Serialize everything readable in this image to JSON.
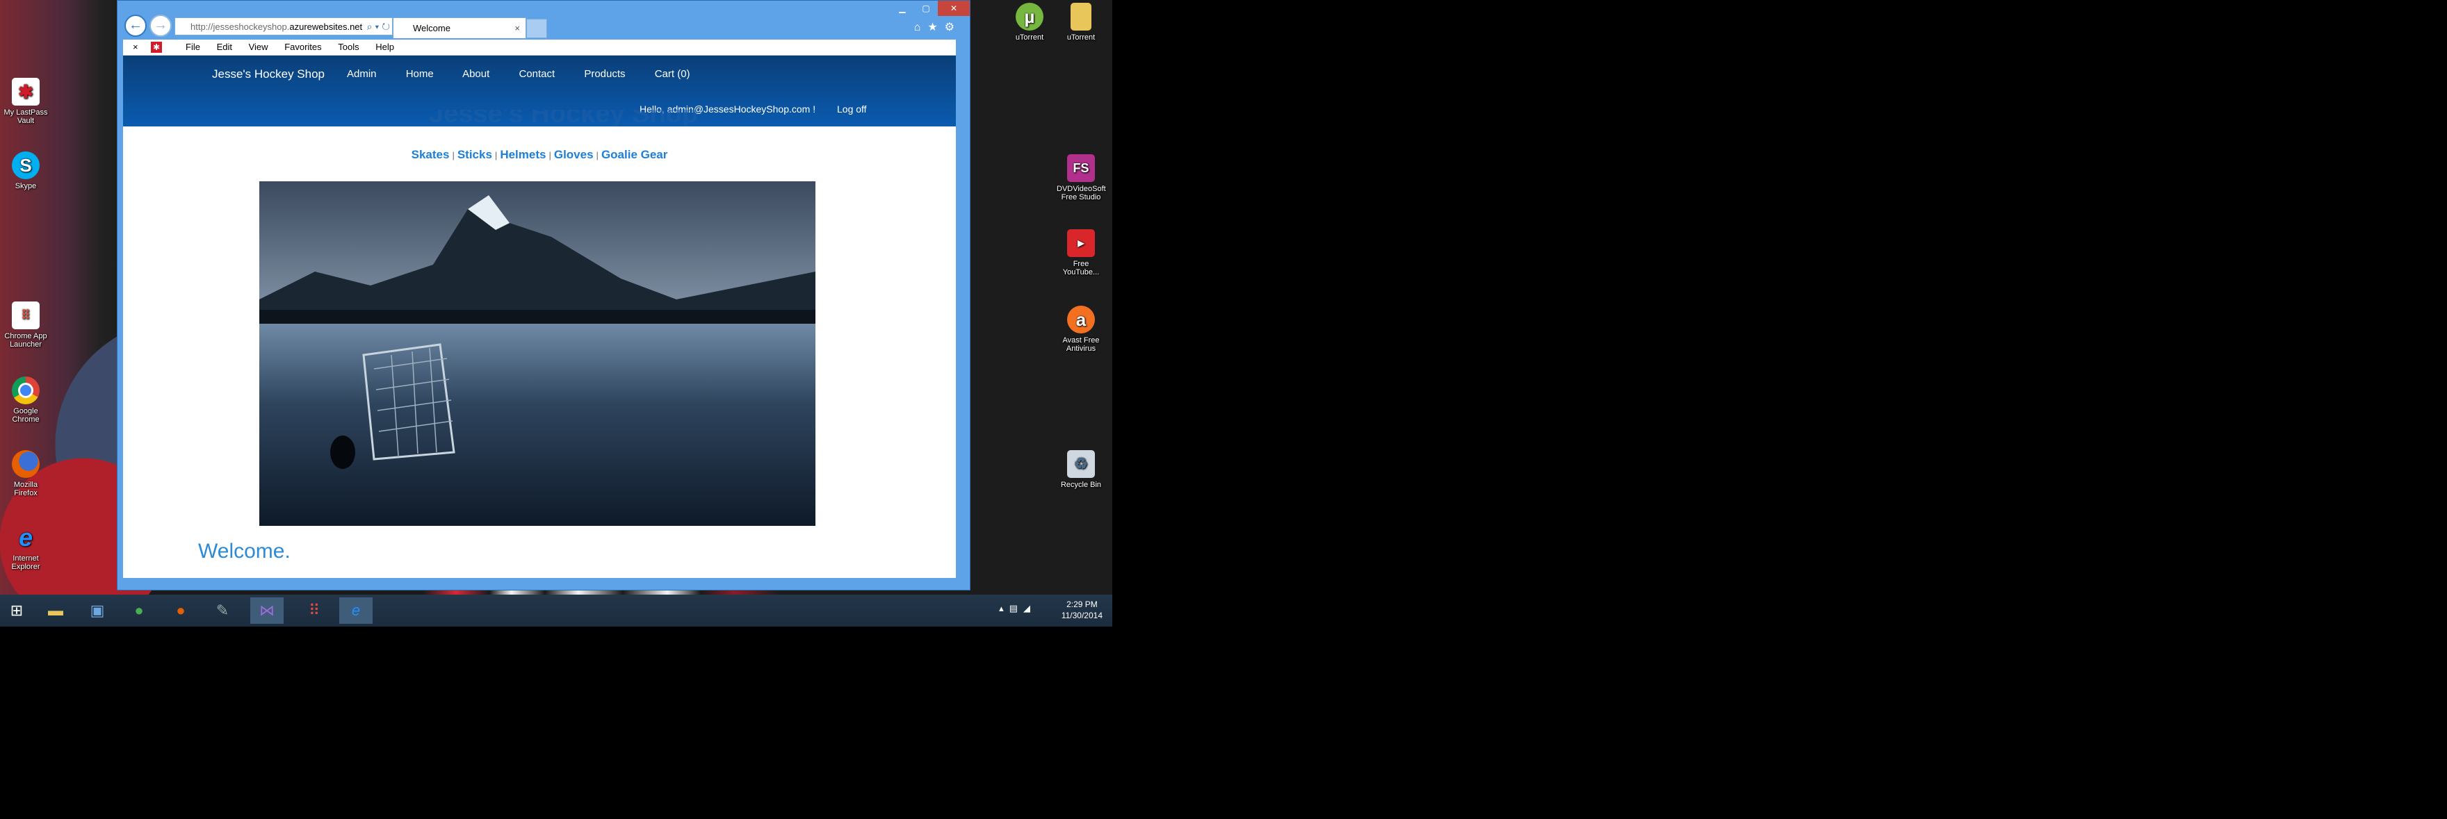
{
  "browser": {
    "address_prefix": "http://jesseshockeyshop.",
    "address_domain": "azurewebsites.net",
    "tab_title": "Welcome",
    "menu": [
      "File",
      "Edit",
      "View",
      "Favorites",
      "Tools",
      "Help"
    ]
  },
  "site": {
    "brand": "Jesse's Hockey Shop",
    "nav": [
      "Admin",
      "Home",
      "About",
      "Contact",
      "Products",
      "Cart (0)"
    ],
    "hello": "Hello, admin@JessesHockeyShop.com !",
    "logoff": "Log off",
    "banner_title": "Jesse's Hockey Shop",
    "categories": [
      "Skates",
      "Sticks",
      "Helmets",
      "Gloves",
      "Goalie Gear"
    ],
    "category_separator": "|",
    "welcome": "Welcome."
  },
  "desktop_icons_left": [
    {
      "label": "My LastPass Vault",
      "icon": "lastpass-icon",
      "color": "#d11b2a"
    },
    {
      "label": "Skype",
      "icon": "skype-icon",
      "color": "#00aff0"
    },
    {
      "label": "Chrome App Launcher",
      "icon": "app-launcher-icon",
      "color": "#ffffff"
    },
    {
      "label": "Google Chrome",
      "icon": "chrome-icon",
      "color": "#4caf50"
    },
    {
      "label": "Mozilla Firefox",
      "icon": "firefox-icon",
      "color": "#e66000"
    },
    {
      "label": "Internet Explorer",
      "icon": "ie-icon",
      "color": "#1e90ff"
    }
  ],
  "desktop_icons_right": [
    {
      "label": "uTorrent",
      "icon": "utorrent-icon",
      "color": "#76b83f"
    },
    {
      "label": "uTorrent",
      "icon": "folder-icon",
      "color": "#e8c65a"
    },
    {
      "label": "DVDVideoSoft Free Studio",
      "icon": "dvdvideosoft-icon",
      "color": "#b0308c"
    },
    {
      "label": "Free YouTube...",
      "icon": "youtube-converter-icon",
      "color": "#d9262a"
    },
    {
      "label": "Avast Free Antivirus",
      "icon": "avast-icon",
      "color": "#f37021"
    },
    {
      "label": "Recycle Bin",
      "icon": "recycle-bin-icon",
      "color": "#cfd8e0"
    }
  ],
  "taskbar": {
    "time": "2:29 PM",
    "date": "11/30/2014"
  }
}
